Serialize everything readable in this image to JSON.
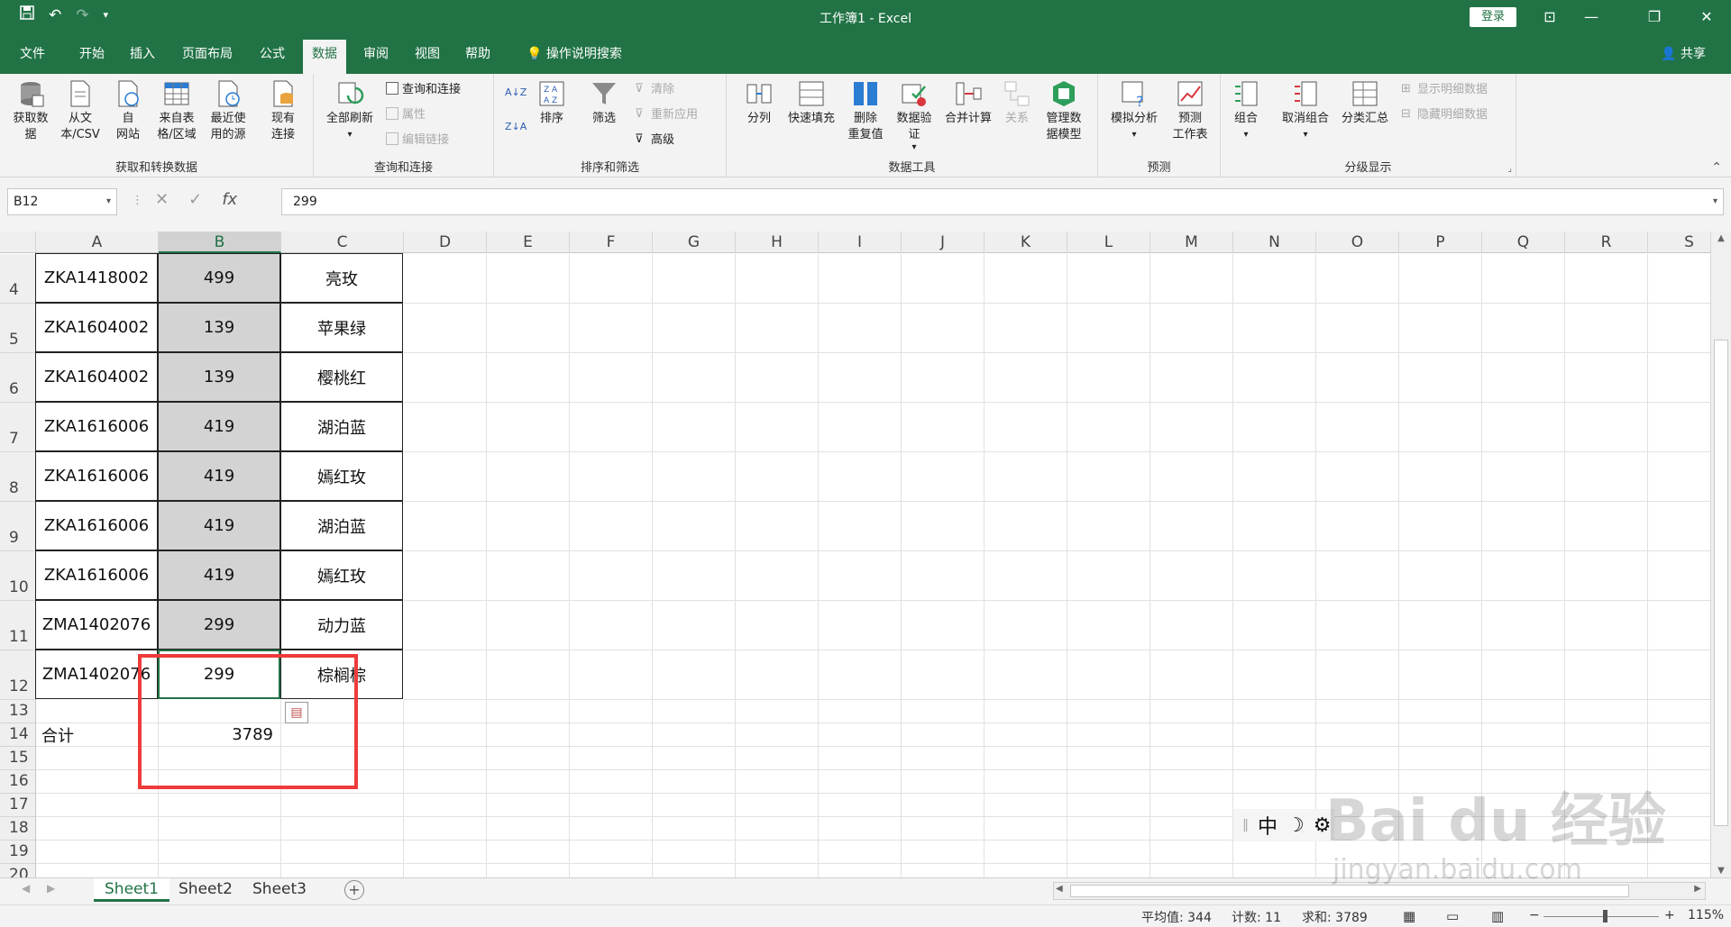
{
  "window": {
    "title": "工作簿1  -  Excel",
    "login": "登录"
  },
  "tabs": [
    "文件",
    "开始",
    "插入",
    "页面布局",
    "公式",
    "数据",
    "审阅",
    "视图",
    "帮助"
  ],
  "tell_me": "操作说明搜索",
  "share": "共享",
  "ribbon": {
    "get_transform": {
      "label": "获取和转换数据",
      "buttons": [
        "获取数\n据",
        "从文\n本/CSV",
        "自\n网站",
        "来自表\n格/区域",
        "最近使\n用的源",
        "现有\n连接"
      ]
    },
    "queries": {
      "label": "查询和连接",
      "refresh_all": "全部刷新",
      "queries_connections": "查询和连接",
      "properties": "属性",
      "edit_links": "编辑链接"
    },
    "sort_filter": {
      "label": "排序和筛选",
      "sort": "排序",
      "filter": "筛选",
      "clear": "清除",
      "reapply": "重新应用",
      "advanced": "高级"
    },
    "data_tools": {
      "label": "数据工具",
      "buttons": [
        "分列",
        "快速填充",
        "删除\n重复值",
        "数据验\n证",
        "合并计算",
        "关系",
        "管理数\n据模型"
      ]
    },
    "forecast": {
      "label": "预测",
      "buttons": [
        "模拟分析",
        "预测\n工作表"
      ]
    },
    "outline": {
      "label": "分级显示",
      "buttons": [
        "组合",
        "取消组合",
        "分类汇总"
      ],
      "show_detail": "显示明细数据",
      "hide_detail": "隐藏明细数据"
    }
  },
  "formula_bar": {
    "name_box": "B12",
    "formula": "299"
  },
  "columns": [
    "A",
    "B",
    "C",
    "D",
    "E",
    "F",
    "G",
    "H",
    "I",
    "J",
    "K",
    "L",
    "M",
    "N",
    "O",
    "P",
    "Q",
    "R",
    "S"
  ],
  "rows": [
    {
      "num": "4",
      "a": "ZKA1418002",
      "b": "499",
      "c": "亮玫"
    },
    {
      "num": "5",
      "a": "ZKA1604002",
      "b": "139",
      "c": "苹果绿"
    },
    {
      "num": "6",
      "a": "ZKA1604002",
      "b": "139",
      "c": "樱桃红"
    },
    {
      "num": "7",
      "a": "ZKA1616006",
      "b": "419",
      "c": "湖泊蓝"
    },
    {
      "num": "8",
      "a": "ZKA1616006",
      "b": "419",
      "c": "嫣红玫"
    },
    {
      "num": "9",
      "a": "ZKA1616006",
      "b": "419",
      "c": "湖泊蓝"
    },
    {
      "num": "10",
      "a": "ZKA1616006",
      "b": "419",
      "c": "嫣红玫"
    },
    {
      "num": "11",
      "a": "ZMA1402076",
      "b": "299",
      "c": "动力蓝"
    },
    {
      "num": "12",
      "a": "ZMA1402076",
      "b": "299",
      "c": "棕榈棕"
    }
  ],
  "extra_rows": [
    {
      "num": "13",
      "a": "",
      "b": ""
    },
    {
      "num": "14",
      "a": "合计",
      "b": "3789"
    },
    {
      "num": "15",
      "a": "",
      "b": ""
    },
    {
      "num": "16",
      "a": "",
      "b": ""
    },
    {
      "num": "17",
      "a": "",
      "b": ""
    },
    {
      "num": "18",
      "a": "",
      "b": ""
    },
    {
      "num": "19",
      "a": "",
      "b": ""
    },
    {
      "num": "20",
      "a": "",
      "b": ""
    }
  ],
  "sheets": [
    "Sheet1",
    "Sheet2",
    "Sheet3"
  ],
  "status": {
    "average": "平均值: 344",
    "count": "计数: 11",
    "sum": "求和: 3789",
    "zoom": "115%"
  },
  "ime": {
    "lang": "中"
  },
  "watermark": {
    "brand": "Bai du 经验",
    "url": "jingyan.baidu.com"
  },
  "colors": {
    "excel_green": "#217346",
    "highlight_red": "#ef3b3b"
  }
}
